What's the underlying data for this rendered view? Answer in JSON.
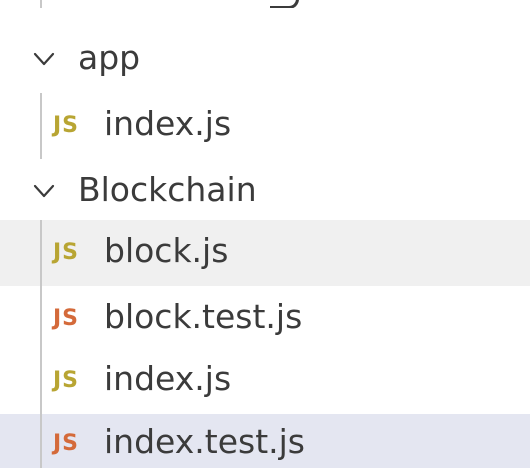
{
  "explorer": {
    "colors": {
      "js_icon": "#b8a533",
      "test_icon": "#d46a3a",
      "hover_bg": "#f0f0f0",
      "selected_bg": "#e4e6f1",
      "text": "#3b3b3b"
    },
    "folders": [
      {
        "label": "app",
        "icon": "chevron-down-icon",
        "files": [
          {
            "icon_text": "JS",
            "icon": "javascript-icon",
            "label": "index.js"
          }
        ]
      },
      {
        "label": "Blockchain",
        "icon": "chevron-down-icon",
        "files": [
          {
            "icon_text": "JS",
            "icon": "javascript-icon",
            "label": "block.js"
          },
          {
            "icon_text": "JS",
            "icon": "javascript-test-icon",
            "label": "block.test.js"
          },
          {
            "icon_text": "JS",
            "icon": "javascript-icon",
            "label": "index.js"
          },
          {
            "icon_text": "JS",
            "icon": "javascript-test-icon",
            "label": "index.test.js"
          }
        ]
      }
    ]
  }
}
